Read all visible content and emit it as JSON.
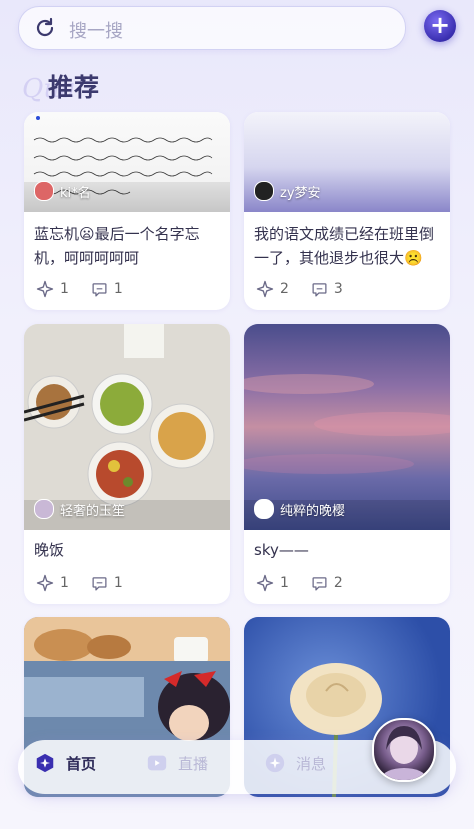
{
  "search": {
    "placeholder": "搜一搜"
  },
  "section": {
    "title": "推荐",
    "deco": "Qua"
  },
  "cards": [
    {
      "author": "ki*名",
      "title": "蓝忘机😦最后一个名字忘机，呵呵呵呵呵",
      "likes": "1",
      "comments": "1"
    },
    {
      "author": "zy梦安",
      "title": "我的语文成绩已经在班里倒一了，其他退步也很大☹️",
      "likes": "2",
      "comments": "3"
    },
    {
      "author": "轻奢的玉笙",
      "title": "晚饭",
      "likes": "1",
      "comments": "1"
    },
    {
      "author": "纯粹的晚樱",
      "title": "sky——",
      "likes": "1",
      "comments": "2"
    }
  ],
  "tabs": {
    "home": "首页",
    "live": "直播",
    "messages": "消息"
  },
  "colors": {
    "accent": "#3a2fb0",
    "text": "#34324e",
    "tab_inactive": "#b9b8d6"
  },
  "icons": [
    "refresh-icon",
    "plus-icon",
    "star-icon",
    "comment-icon",
    "home-icon",
    "live-icon",
    "message-icon"
  ]
}
